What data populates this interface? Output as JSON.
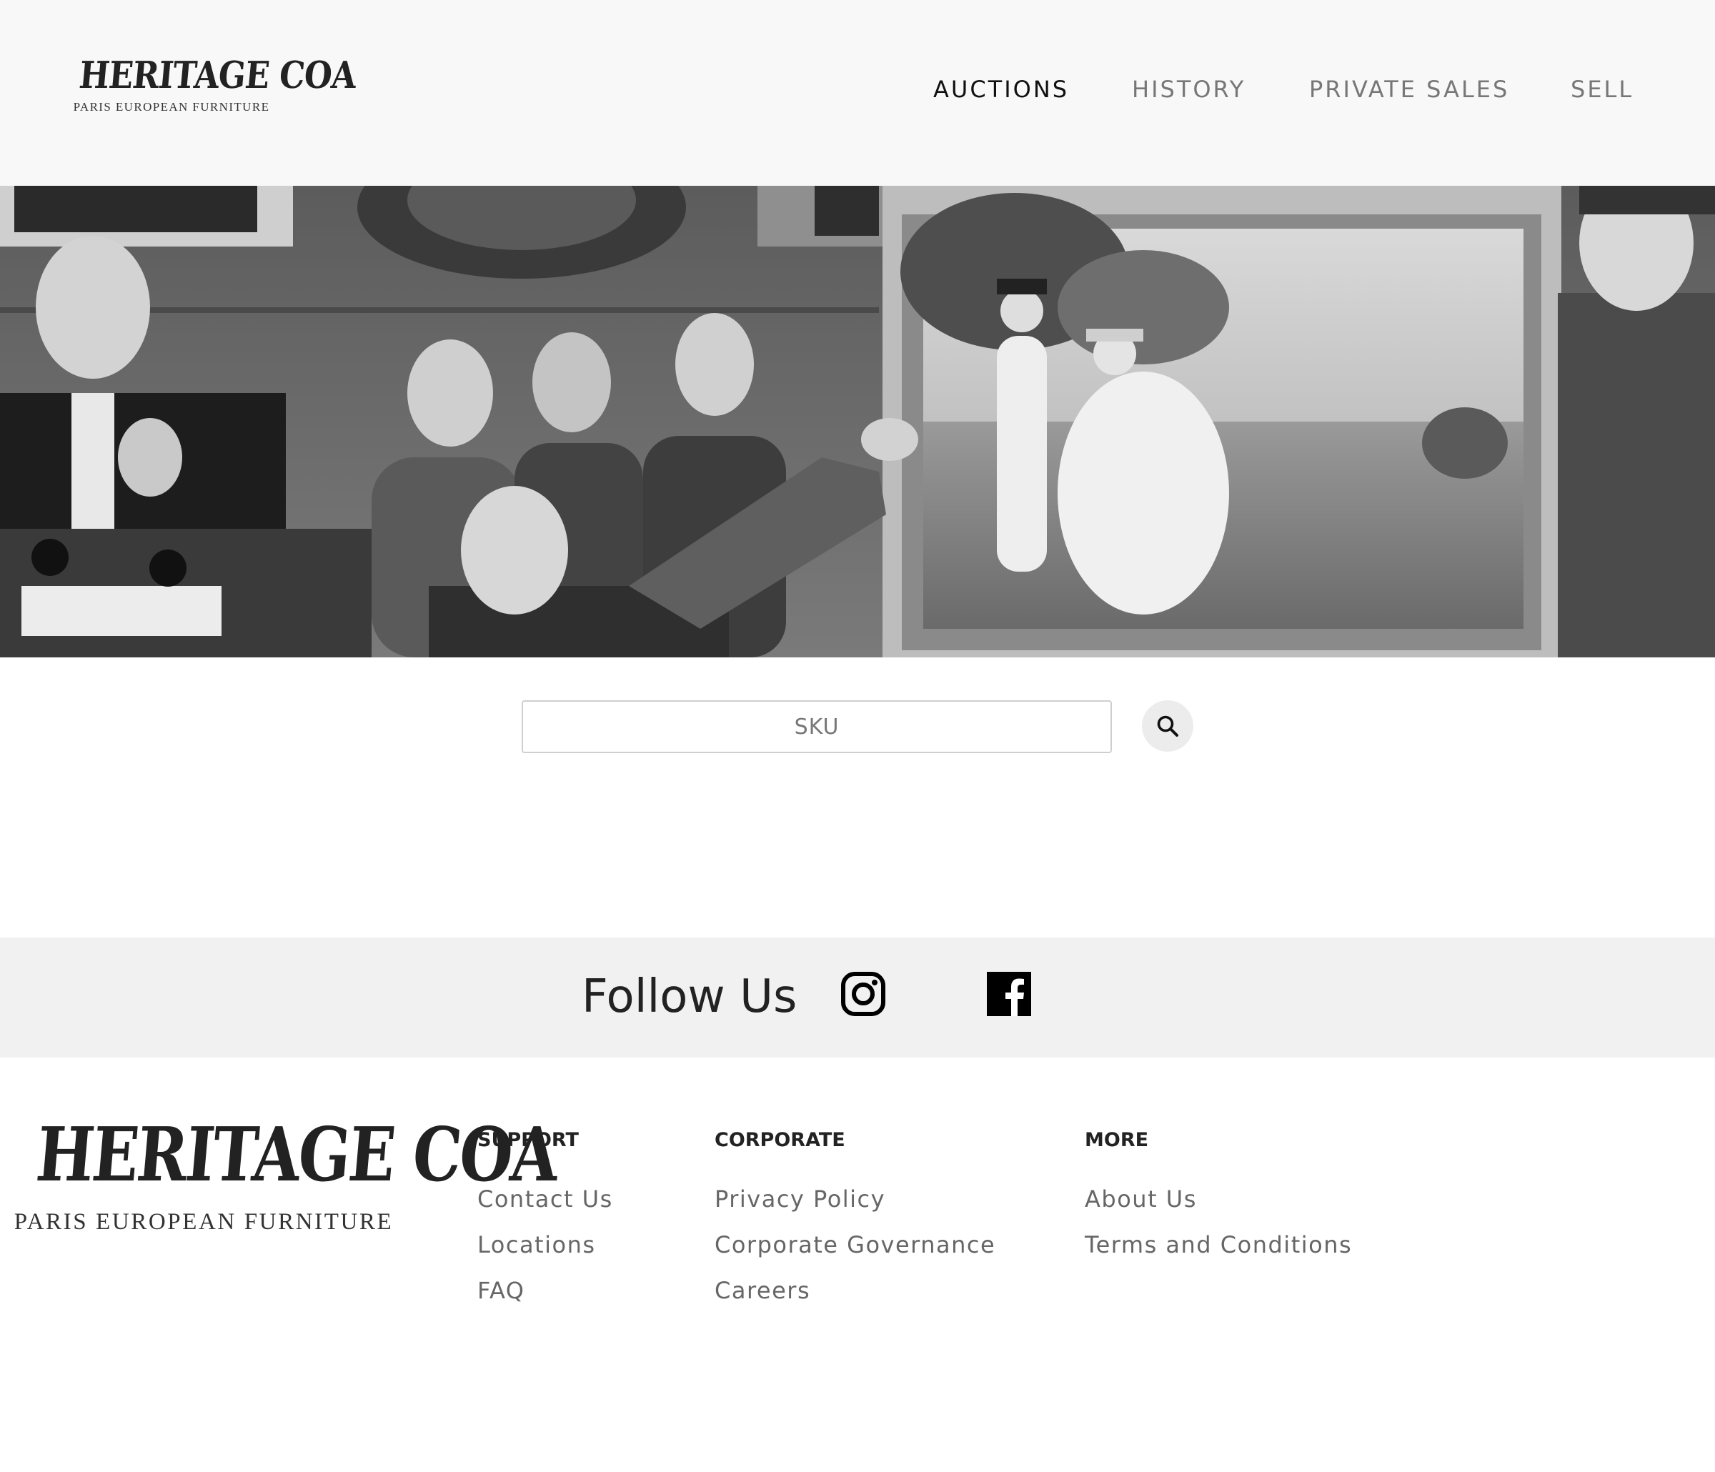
{
  "brand": {
    "name": "HERITAGE COA",
    "tagline": "PARIS EUROPEAN FURNITURE"
  },
  "nav": {
    "items": [
      {
        "label": "AUCTIONS",
        "active": true
      },
      {
        "label": "HISTORY",
        "active": false
      },
      {
        "label": "PRIVATE SALES",
        "active": false
      },
      {
        "label": "SELL",
        "active": false
      }
    ]
  },
  "hero": {
    "icon": "auction-hall-photo"
  },
  "search": {
    "placeholder": "SKU",
    "value": "",
    "button_icon": "search-icon"
  },
  "follow": {
    "title": "Follow Us",
    "icons": [
      "instagram-icon",
      "facebook-icon"
    ]
  },
  "footer": {
    "columns": [
      {
        "heading": "SUPPORT",
        "links": [
          "Contact Us",
          "Locations",
          "FAQ"
        ]
      },
      {
        "heading": "CORPORATE",
        "links": [
          "Privacy Policy",
          "Corporate Governance",
          "Careers"
        ]
      },
      {
        "heading": "MORE",
        "links": [
          "About Us",
          "Terms and Conditions"
        ]
      }
    ]
  },
  "colors": {
    "header_bg": "#f8f8f8",
    "follow_bg": "#f1f1f1",
    "nav_active": "#111111",
    "nav_inactive": "#777777",
    "link": "#666666"
  }
}
